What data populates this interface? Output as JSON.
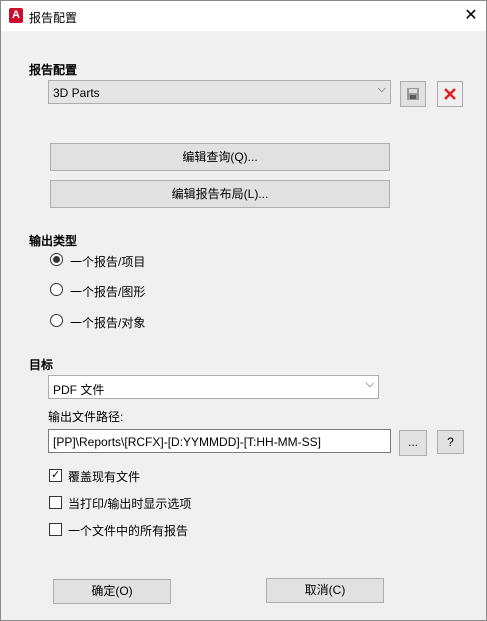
{
  "window": {
    "title": "报告配置",
    "close": "✕"
  },
  "config_section": {
    "label": "报告配置",
    "selected": "3D Parts",
    "save_icon": "save-icon",
    "delete_icon": "delete-icon"
  },
  "buttons": {
    "edit_query": "编辑查询(Q)...",
    "edit_layout": "编辑报告布局(L)..."
  },
  "output_type": {
    "label": "输出类型",
    "options": [
      {
        "label": "一个报告/项目",
        "checked": true
      },
      {
        "label": "一个报告/图形",
        "checked": false
      },
      {
        "label": "一个报告/对象",
        "checked": false
      }
    ]
  },
  "target": {
    "label": "目标",
    "selected": "PDF 文件",
    "path_label": "输出文件路径:",
    "path_value": "[PP]\\Reports\\[RCFX]-[D:YYMMDD]-[T:HH-MM-SS]",
    "browse": "...",
    "help": "?"
  },
  "checkboxes": [
    {
      "label": "覆盖现有文件",
      "checked": true
    },
    {
      "label": "当打印/输出时显示选项",
      "checked": false
    },
    {
      "label": "一个文件中的所有报告",
      "checked": false
    }
  ],
  "footer": {
    "ok": "确定(O)",
    "cancel": "取消(C)"
  },
  "colors": {
    "delete_x": "#e02020",
    "accent": "#c8102e"
  }
}
